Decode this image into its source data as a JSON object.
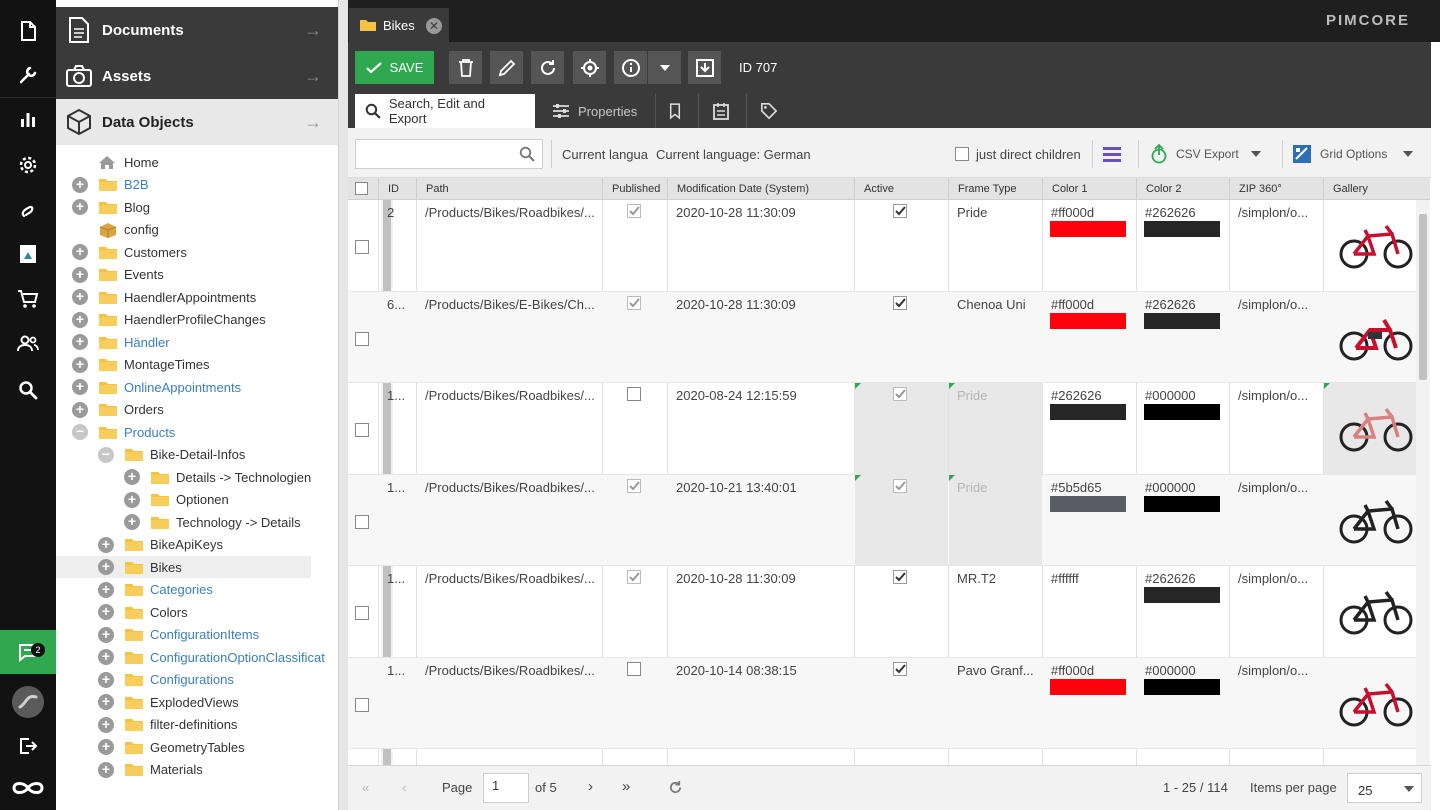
{
  "rail": {
    "notification_count": "2"
  },
  "tree_panel": {
    "accordion": {
      "documents": "Documents",
      "assets": "Assets",
      "data_objects": "Data Objects"
    },
    "tree": [
      {
        "label": "Home",
        "level": 0,
        "type": "home",
        "blue": false,
        "state": "none"
      },
      {
        "label": "B2B",
        "level": 0,
        "type": "folder",
        "blue": true,
        "state": "plus"
      },
      {
        "label": "Blog",
        "level": 0,
        "type": "folder",
        "blue": false,
        "state": "plus"
      },
      {
        "label": "config",
        "level": 0,
        "type": "box",
        "blue": false,
        "state": "none"
      },
      {
        "label": "Customers",
        "level": 0,
        "type": "folder",
        "blue": false,
        "state": "plus"
      },
      {
        "label": "Events",
        "level": 0,
        "type": "folder",
        "blue": false,
        "state": "plus"
      },
      {
        "label": "HaendlerAppointments",
        "level": 0,
        "type": "folder",
        "blue": false,
        "state": "plus"
      },
      {
        "label": "HaendlerProfileChanges",
        "level": 0,
        "type": "folder",
        "blue": false,
        "state": "plus"
      },
      {
        "label": "Händler",
        "level": 0,
        "type": "folder",
        "blue": true,
        "state": "plus"
      },
      {
        "label": "MontageTimes",
        "level": 0,
        "type": "folder",
        "blue": false,
        "state": "plus"
      },
      {
        "label": "OnlineAppointments",
        "level": 0,
        "type": "folder",
        "blue": true,
        "state": "plus"
      },
      {
        "label": "Orders",
        "level": 0,
        "type": "folder",
        "blue": false,
        "state": "plus"
      },
      {
        "label": "Products",
        "level": 0,
        "type": "folder",
        "blue": true,
        "state": "minus"
      },
      {
        "label": "Bike-Detail-Infos",
        "level": 1,
        "type": "folder",
        "blue": false,
        "state": "minus"
      },
      {
        "label": "Details -> Technologien",
        "level": 2,
        "type": "folder",
        "blue": false,
        "state": "plus"
      },
      {
        "label": "Optionen",
        "level": 2,
        "type": "folder",
        "blue": false,
        "state": "plus"
      },
      {
        "label": "Technology -> Details",
        "level": 2,
        "type": "folder",
        "blue": false,
        "state": "plus"
      },
      {
        "label": "BikeApiKeys",
        "level": 1,
        "type": "folder",
        "blue": false,
        "state": "plus"
      },
      {
        "label": "Bikes",
        "level": 1,
        "type": "folder",
        "blue": false,
        "state": "plus",
        "selected": true
      },
      {
        "label": "Categories",
        "level": 1,
        "type": "folder",
        "blue": true,
        "state": "plus"
      },
      {
        "label": "Colors",
        "level": 1,
        "type": "folder",
        "blue": false,
        "state": "plus"
      },
      {
        "label": "ConfigurationItems",
        "level": 1,
        "type": "folder",
        "blue": true,
        "state": "plus"
      },
      {
        "label": "ConfigurationOptionClassificat",
        "level": 1,
        "type": "folder",
        "blue": true,
        "state": "plus"
      },
      {
        "label": "Configurations",
        "level": 1,
        "type": "folder",
        "blue": true,
        "state": "plus"
      },
      {
        "label": "ExplodedViews",
        "level": 1,
        "type": "folder",
        "blue": false,
        "state": "plus"
      },
      {
        "label": "filter-definitions",
        "level": 1,
        "type": "folder",
        "blue": false,
        "state": "plus"
      },
      {
        "label": "GeometryTables",
        "level": 1,
        "type": "folder",
        "blue": false,
        "state": "plus"
      },
      {
        "label": "Materials",
        "level": 1,
        "type": "folder",
        "blue": false,
        "state": "plus"
      }
    ]
  },
  "topbar": {
    "tab_label": "Bikes",
    "logo": "PIMCORE"
  },
  "toolbar": {
    "save_label": "SAVE",
    "id_label": "ID 707"
  },
  "subtabs": {
    "search": "Search, Edit and Export",
    "properties": "Properties"
  },
  "filter": {
    "search_placeholder": "",
    "current_language_short": "Current langua",
    "current_language": "Current language: German",
    "direct_children": "just direct children",
    "csv_export": "CSV Export",
    "grid_options": "Grid Options"
  },
  "grid": {
    "columns": [
      "ID",
      "Path",
      "Published",
      "Modification Date (System)",
      "Active",
      "Frame Type",
      "Color 1",
      "Color 2",
      "ZIP 360°",
      "Gallery"
    ],
    "rows": [
      {
        "id": "2",
        "path": "/Products/Bikes/Roadbikes/...",
        "published": true,
        "modified": "2020-10-28 11:30:09",
        "active": true,
        "frame": "Pride",
        "color1": "#ff000d",
        "color1_hex": "#ff000d",
        "color2": "#262626",
        "color2_hex": "#262626",
        "zip": "/simplon/o...",
        "inherited": false,
        "bike_color": "#c8102e",
        "bike_type": "road"
      },
      {
        "id": "6...",
        "path": "/Products/Bikes/E-Bikes/Ch...",
        "published": true,
        "modified": "2020-10-28 11:30:09",
        "active": true,
        "frame": "Chenoa Uni",
        "color1": "#ff000d",
        "color1_hex": "#ff000d",
        "color2": "#262626",
        "color2_hex": "#262626",
        "zip": "/simplon/o...",
        "inherited": false,
        "bike_color": "#c8102e",
        "bike_type": "ebike"
      },
      {
        "id": "1...",
        "path": "/Products/Bikes/Roadbikes/...",
        "published": false,
        "modified": "2020-08-24 12:15:59",
        "active": true,
        "frame": "Pride",
        "color1": "#262626",
        "color1_hex": "#262626",
        "color2": "#000000",
        "color2_hex": "#000000",
        "zip": "/simplon/o...",
        "inherited": true,
        "bike_color": "#d98080",
        "bike_type": "road"
      },
      {
        "id": "1...",
        "path": "/Products/Bikes/Roadbikes/...",
        "published": true,
        "modified": "2020-10-21 13:40:01",
        "active": true,
        "frame": "Pride",
        "color1": "#5b5d65",
        "color1_hex": "#5b5d65",
        "color2": "#000000",
        "color2_hex": "#000000",
        "zip": "/simplon/o...",
        "inherited": true,
        "bike_color": "#222222",
        "bike_type": "road"
      },
      {
        "id": "1...",
        "path": "/Products/Bikes/Roadbikes/...",
        "published": true,
        "modified": "2020-10-28 11:30:09",
        "active": true,
        "frame": "MR.T2",
        "color1": "#ffffff",
        "color1_hex": "",
        "color2": "#262626",
        "color2_hex": "#262626",
        "zip": "/simplon/o...",
        "inherited": false,
        "bike_color": "#222222",
        "bike_type": "road"
      },
      {
        "id": "1...",
        "path": "/Products/Bikes/Roadbikes/...",
        "published": false,
        "modified": "2020-10-14 08:38:15",
        "active": true,
        "frame": "Pavo Granf...",
        "color1": "#ff000d",
        "color1_hex": "#ff000d",
        "color2": "#000000",
        "color2_hex": "#000000",
        "zip": "/simplon/o...",
        "inherited": false,
        "bike_color": "#c8102e",
        "bike_type": "road"
      }
    ]
  },
  "pager": {
    "page_label": "Page",
    "page_value": "1",
    "of_label": "of 5",
    "range": "1 - 25 / 114",
    "items_label": "Items per page",
    "per_page": "25"
  },
  "colors": {
    "accent": "#2fa84f",
    "dark": "#3a3a3a",
    "topbar": "#1f1f1f",
    "link": "#3a7fc4",
    "folder": "#f5c342"
  }
}
